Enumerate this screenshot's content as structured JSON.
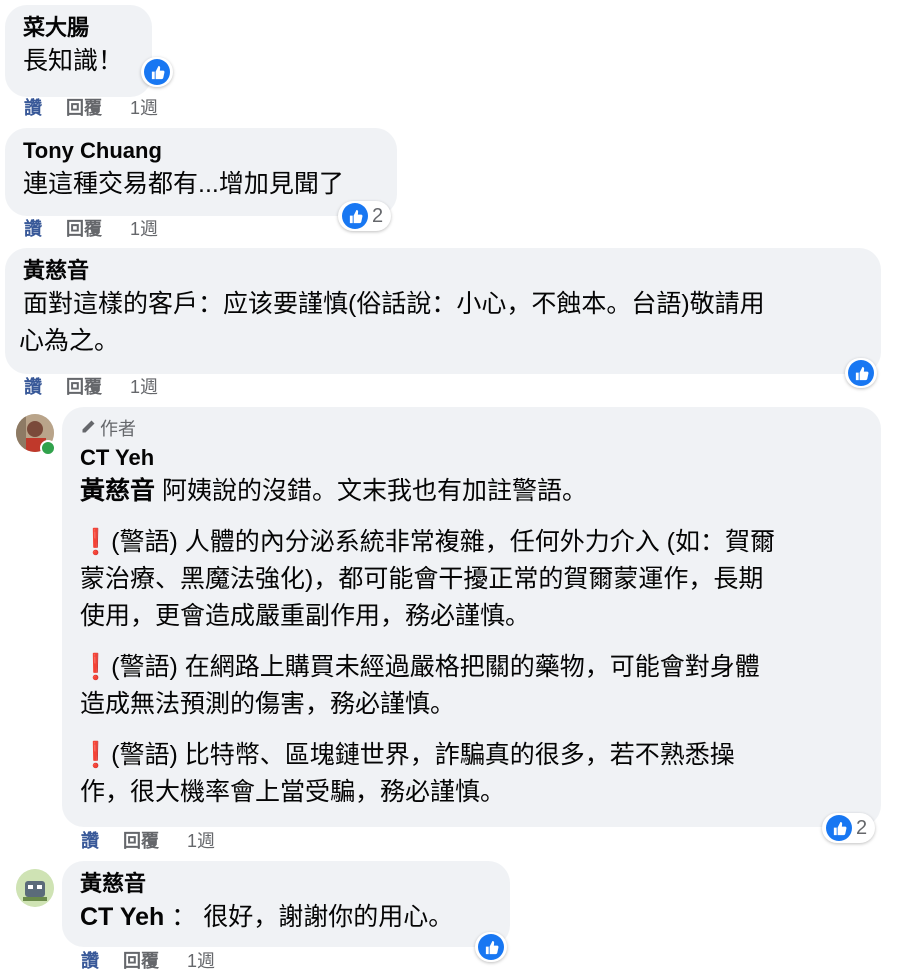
{
  "labels": {
    "like": "讚",
    "reply": "回覆"
  },
  "comments": [
    {
      "name": "菜大腸",
      "text": "長知識！",
      "time": "1週",
      "reactions": ""
    },
    {
      "name": "Tony Chuang",
      "text": "連這種交易都有...增加見聞了",
      "time": "1週",
      "reactions": "2"
    },
    {
      "name": "黃慈音",
      "text_line1": "面對這樣的客戶：应该要謹慎(俗話說：小心，不蝕本。台語)敬請用",
      "text_line2": "心為之。",
      "time": "1週",
      "reactions": ""
    },
    {
      "author_tag": "作者",
      "name": "CT Yeh",
      "mention": "黃慈音",
      "intro": "阿姨說的沒錯。文末我也有加註警語。",
      "warning_mark": "❗",
      "warnings": [
        {
          "line1": "(警語) 人體的內分泌系統非常複雜，任何外力介入 (如：賀爾",
          "line2": "蒙治療、黑魔法強化)，都可能會干擾正常的賀爾蒙運作，長期",
          "line3": "使用，更會造成嚴重副作用，務必謹慎。"
        },
        {
          "line1": "(警語) 在網路上購買未經過嚴格把關的藥物，可能會對身體",
          "line2": "造成無法預測的傷害，務必謹慎。"
        },
        {
          "line1": "(警語) 比特幣、區塊鏈世界，詐騙真的很多，若不熟悉操",
          "line2": "作，很大機率會上當受騙，務必謹慎。"
        }
      ],
      "time": "1週",
      "reactions": "2"
    },
    {
      "name": "黃慈音",
      "mention": "CT Yeh",
      "text": "：  很好，謝謝你的用心。",
      "time": "1週",
      "reactions": ""
    }
  ],
  "colors": {
    "bubble": "#f0f2f5",
    "like_blue": "#1877f2",
    "meta_gray": "#65676b",
    "online_green": "#31a24c"
  },
  "icons": [
    "thumbs-up-icon",
    "pencil-icon",
    "avatar-image"
  ]
}
